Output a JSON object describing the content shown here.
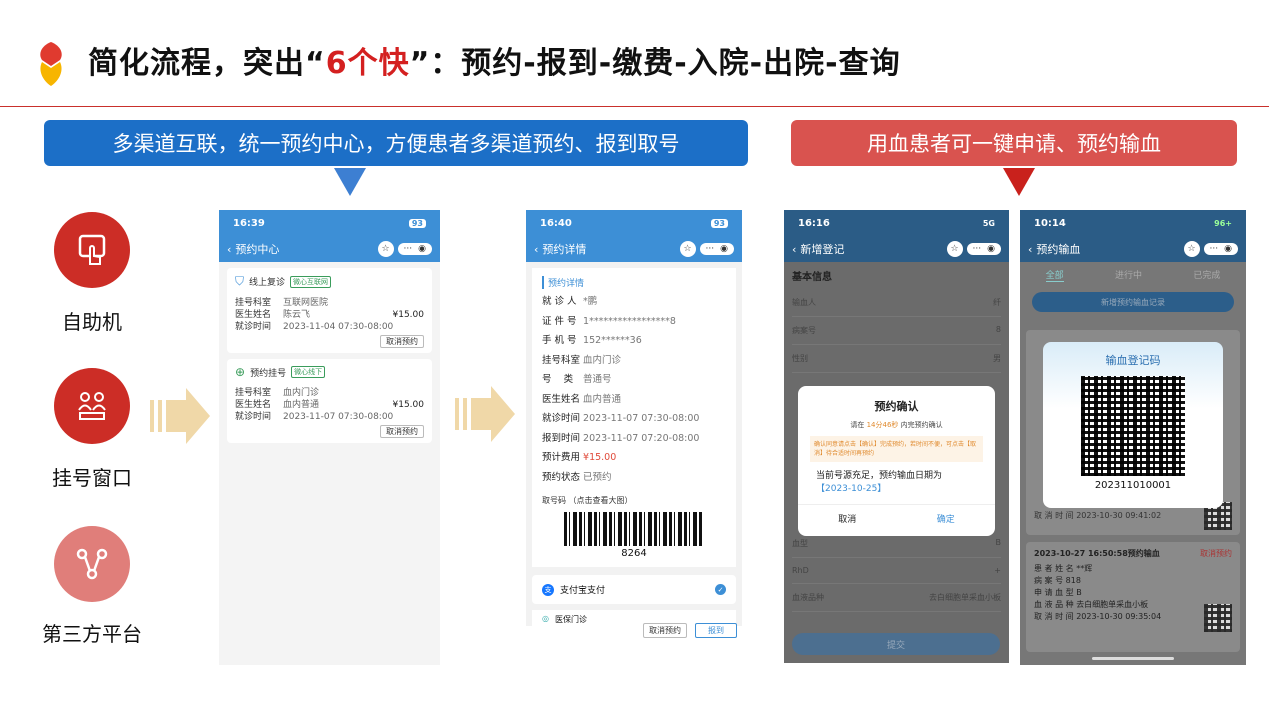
{
  "title": {
    "part1": "简化流程，突出“",
    "highlight": "6个快",
    "part2": "”：预约-报到-缴费-入院-出院-查询"
  },
  "banner_left": "多渠道互联，统一预约中心，方便患者多渠道预约、报到取号",
  "banner_right": "用血患者可一键申请、预约输血",
  "channels": [
    {
      "label": "自助机",
      "icon": "touch-screen-icon"
    },
    {
      "label": "挂号窗口",
      "icon": "people-counter-icon"
    },
    {
      "label": "第三方平台",
      "icon": "share-network-icon"
    }
  ],
  "colors": {
    "blue": "#1c6fc7",
    "red": "#d9534f",
    "title_highlight": "#d42020"
  },
  "phone1": {
    "time": "16:39",
    "signal": "93",
    "nav_title": "预约中心",
    "cards": [
      {
        "type": "线上复诊",
        "tag": "微心互联网",
        "dept_label": "挂号科室",
        "dept": "互联网医院",
        "doc_label": "医生姓名",
        "doc": "陈云飞",
        "price": "¥15.00",
        "time_label": "就诊时间",
        "time": "2023-11-04 07:30-08:00",
        "cancel": "取消预约"
      },
      {
        "type": "预约挂号",
        "tag": "微心线下",
        "dept_label": "挂号科室",
        "dept": "血内门诊",
        "doc_label": "医生姓名",
        "doc": "血内普通",
        "price": "¥15.00",
        "time_label": "就诊时间",
        "time": "2023-11-07 07:30-08:00",
        "cancel": "取消预约"
      }
    ]
  },
  "phone2": {
    "time": "16:40",
    "signal": "93",
    "nav_title": "预约详情",
    "section": "预约详情",
    "rows": [
      {
        "k": "就 诊 人",
        "v": "*鹏"
      },
      {
        "k": "证 件 号",
        "v": "1*****************8"
      },
      {
        "k": "手 机 号",
        "v": "152******36"
      },
      {
        "k": "挂号科室",
        "v": "血内门诊"
      },
      {
        "k": "号    类",
        "v": "普通号"
      },
      {
        "k": "医生姓名",
        "v": "血内普通"
      },
      {
        "k": "就诊时间",
        "v": "2023-11-07 07:30-08:00"
      },
      {
        "k": "报到时间",
        "v": "2023-11-07 07:20-08:00"
      },
      {
        "k": "预计费用",
        "v": "¥15.00"
      },
      {
        "k": "预约状态",
        "v": "已预约"
      }
    ],
    "barcode_label": "取号码 （点击查看大图）",
    "barcode_num": "8264",
    "pay": "支付宝支付",
    "pay2": "医保门诊",
    "cancel": "取消预约",
    "checkin": "报到"
  },
  "phone3": {
    "time": "16:16",
    "signal": "5G",
    "nav_title": "新增登记",
    "section": "基本信息",
    "fields": [
      {
        "k": "输血人",
        "v": "纤"
      },
      {
        "k": "病案号",
        "v": "8"
      },
      {
        "k": "性别",
        "v": "男"
      }
    ],
    "fields2": [
      {
        "k": "血型",
        "v": "B"
      },
      {
        "k": "RhD",
        "v": "+"
      },
      {
        "k": "血液品种",
        "v": "去白细胞单采血小板"
      }
    ],
    "modal": {
      "title": "预约确认",
      "line1a": "请在",
      "countdown": "14分46秒",
      "line1b": "内完预约确认",
      "notice": "确认同意请点击【确认】完成预约，若时间不便，可点击【取消】待合适时间再预约",
      "msg": "当前号源充足，预约输血日期为",
      "date": "【2023-10-25】",
      "cancel": "取消",
      "ok": "确定"
    },
    "submit": "提交"
  },
  "phone4": {
    "time": "10:14",
    "signal": "96+",
    "nav_title": "预约输血",
    "tabs": [
      "全部",
      "进行中",
      "已完成"
    ],
    "new_btn": "新增预约输血记录",
    "qr_title": "输血登记码",
    "qr_num": "202311010001",
    "rec1": {
      "cancel_time_label": "取 消 时 间",
      "cancel_time": "2023-10-30 09:41:02"
    },
    "rec2": {
      "header": "2023-10-27 16:50:58预约输血",
      "cancel": "取消预约",
      "rows": [
        {
          "k": "患 者 姓 名",
          "v": "**辉"
        },
        {
          "k": "病   案   号",
          "v": "818"
        },
        {
          "k": "申 请 血 型",
          "v": "B"
        },
        {
          "k": "血 液 品 种",
          "v": "去白细胞单采血小板"
        },
        {
          "k": "取 消 时 间",
          "v": "2023-10-30 09:35:04"
        }
      ]
    }
  }
}
